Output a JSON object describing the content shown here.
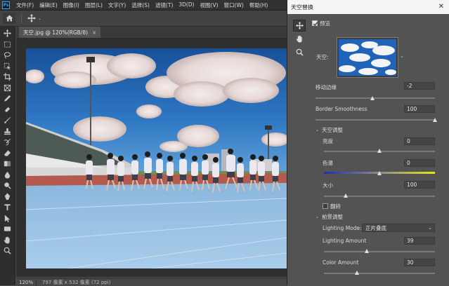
{
  "app": {
    "logo_text": "Ps"
  },
  "menu": [
    "文件(F)",
    "编辑(E)",
    "图像(I)",
    "图层(L)",
    "文字(Y)",
    "选择(S)",
    "滤镜(T)",
    "3D(D)",
    "视图(V)",
    "窗口(W)",
    "帮助(H)"
  ],
  "document": {
    "tab_title": "天空.jpg @ 120%(RGB/8)",
    "close": "×"
  },
  "status": {
    "zoom": "120%",
    "info": "797 像素 x 532 像素 (72 ppi)"
  },
  "dialog": {
    "title": "天空替换",
    "preview_label": "预览",
    "preview_checked": true,
    "sky_label": "天空:",
    "shift_edge": {
      "label": "移动边缘",
      "value": "-2",
      "range": [
        -50,
        50
      ]
    },
    "border_smoothness": {
      "label": "Border Smoothness",
      "value": "100",
      "range": [
        0,
        100
      ]
    },
    "sky_adjust": {
      "label": "天空调整",
      "brightness": {
        "label": "亮度",
        "value": "0",
        "range": [
          -100,
          100
        ]
      },
      "temperature": {
        "label": "色温",
        "value": "0",
        "range": [
          -100,
          100
        ]
      },
      "scale": {
        "label": "大小",
        "value": "100",
        "range": [
          25,
          400
        ]
      },
      "flip_label": "翻转",
      "flip_checked": false
    },
    "foreground_adjust": {
      "label": "前景调整",
      "lighting_mode_label": "Lighting Mode:",
      "lighting_mode_value": "正片叠底",
      "lighting_amount": {
        "label": "Lighting Amount",
        "value": "39",
        "range": [
          0,
          100
        ]
      },
      "color_amount": {
        "label": "Color Amount",
        "value": "30",
        "range": [
          0,
          100
        ]
      }
    }
  },
  "colors": {
    "accent": "#31a8ff",
    "panel_bg": "#535353",
    "menubar_bg": "#323232",
    "sky_blue": "#1d5fa8"
  },
  "icons": {
    "toolbar": [
      "move-icon",
      "marquee-icon",
      "lasso-icon",
      "object-select-icon",
      "crop-icon",
      "frame-icon",
      "eyedropper-icon",
      "healing-brush-icon",
      "brush-icon",
      "clone-stamp-icon",
      "history-brush-icon",
      "eraser-icon",
      "gradient-icon",
      "blur-icon",
      "dodge-icon",
      "pen-icon",
      "type-icon",
      "path-select-icon",
      "rectangle-icon",
      "hand-icon",
      "zoom-icon"
    ],
    "dialog_tools": [
      "sky-move-icon",
      "sky-hand-icon",
      "sky-zoom-icon"
    ]
  }
}
